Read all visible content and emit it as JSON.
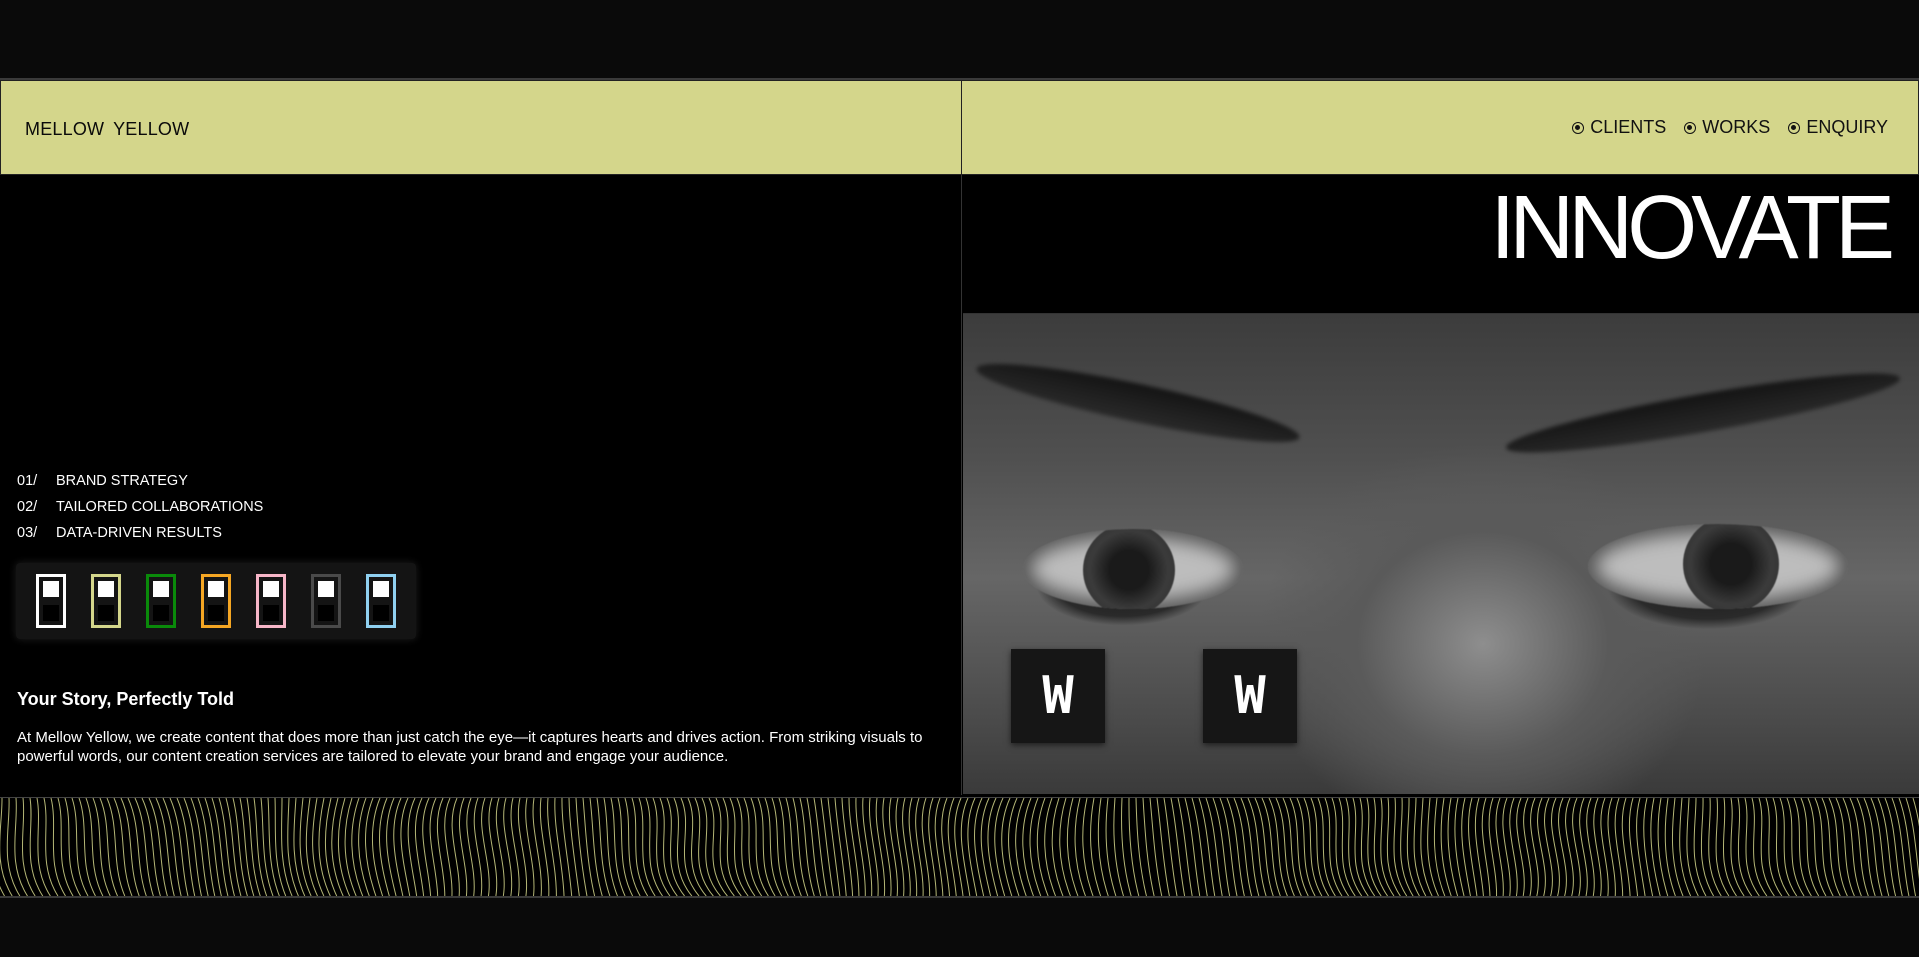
{
  "header": {
    "brand": "MELLOW  YELLOW",
    "nav": [
      {
        "label": "CLIENTS",
        "icon": "radio-dot-icon"
      },
      {
        "label": "WORKS",
        "icon": "radio-dot-icon"
      },
      {
        "label": "ENQUIRY",
        "icon": "radio-dot-icon"
      }
    ]
  },
  "hero": {
    "headline": "INNOVATE",
    "buttons": [
      {
        "label": "W"
      },
      {
        "label": "W"
      }
    ]
  },
  "services": [
    {
      "num": "01/",
      "label": "BRAND STRATEGY"
    },
    {
      "num": "02/",
      "label": "TAILORED COLLABORATIONS"
    },
    {
      "num": "03/",
      "label": "DATA-DRIVEN RESULTS"
    }
  ],
  "theme_swatches": [
    {
      "border": "#ffffff",
      "top": "#ffffff",
      "bottom": "#000000"
    },
    {
      "border": "#d4d68b",
      "top": "#ffffff",
      "bottom": "#000000"
    },
    {
      "border": "#0a8a0a",
      "top": "#ffffff",
      "bottom": "#000000"
    },
    {
      "border": "#f5a623",
      "top": "#ffffff",
      "bottom": "#000000"
    },
    {
      "border": "#f7b6c8",
      "top": "#ffffff",
      "bottom": "#000000"
    },
    {
      "border": "#4a4a4a",
      "top": "#ffffff",
      "bottom": "#000000"
    },
    {
      "border": "#8fd0f0",
      "top": "#ffffff",
      "bottom": "#000000"
    }
  ],
  "story": {
    "title": "Your Story, Perfectly Told",
    "body": "At Mellow Yellow, we create content that does more than just catch the eye—it captures hearts and drives action. From striking visuals to powerful words, our content creation services are tailored to elevate your brand and engage your audience."
  },
  "colors": {
    "accent": "#d4d68b",
    "background": "#000000",
    "line_pattern": "#d4d68b"
  }
}
